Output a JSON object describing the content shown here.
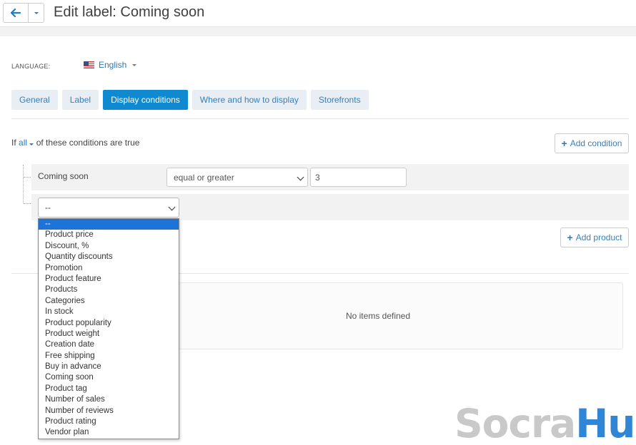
{
  "header": {
    "title": "Edit label: Coming soon"
  },
  "language": {
    "label": "LANGUAGE:",
    "value": "English"
  },
  "tabs": [
    {
      "label": "General",
      "active": false
    },
    {
      "label": "Label",
      "active": false
    },
    {
      "label": "Display conditions",
      "active": true
    },
    {
      "label": "Where and how to display",
      "active": false
    },
    {
      "label": "Storefronts",
      "active": false
    }
  ],
  "conditions": {
    "prefix": "If",
    "mode": "all",
    "suffix": "of these conditions are true",
    "add_condition_label": "Add condition",
    "rows": [
      {
        "name": "Coming soon",
        "operator": "equal or greater",
        "value": "3"
      }
    ],
    "new_condition_select": "--"
  },
  "products": {
    "add_product_label": "Add product",
    "empty_text": "No items defined"
  },
  "dropdown": {
    "options": [
      "--",
      "Product price",
      "Discount, %",
      "Quantity discounts",
      "Promotion",
      "Product feature",
      "Products",
      "Categories",
      "In stock",
      "Product popularity",
      "Product weight",
      "Creation date",
      "Free shipping",
      "Buy in advance",
      "Coming soon",
      "Product tag",
      "Number of sales",
      "Number of reviews",
      "Product rating",
      "Vendor plan"
    ],
    "selected": "--"
  },
  "watermark": {
    "part1": "Socra",
    "part2": "Hub"
  },
  "colors": {
    "accent": "#0f8ad1",
    "link": "#2a7ab7",
    "selected_option": "#1e73d8"
  }
}
